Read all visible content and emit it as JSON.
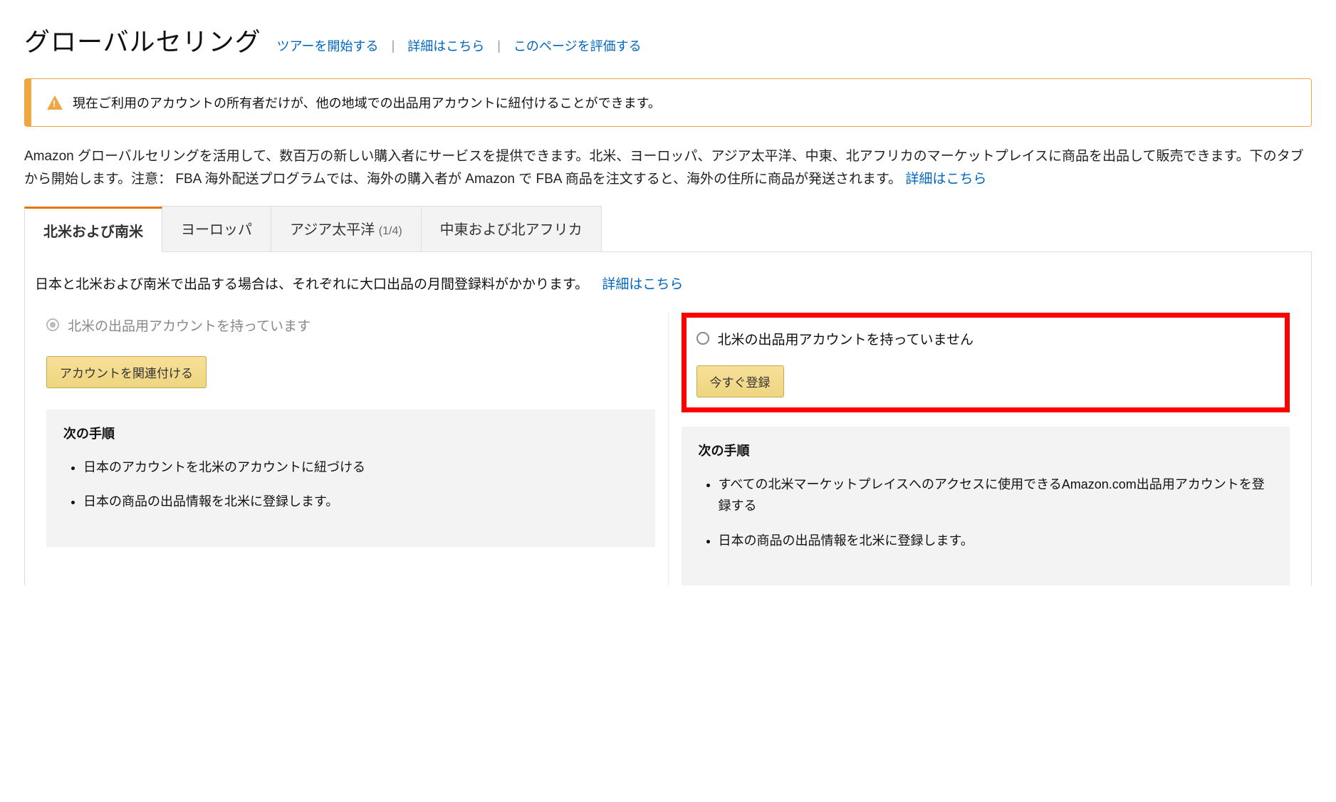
{
  "header": {
    "title": "グローバルセリング",
    "links": {
      "tour": "ツアーを開始する",
      "details": "詳細はこちら",
      "rate": "このページを評価する"
    }
  },
  "alert": {
    "text": "現在ご利用のアカウントの所有者だけが、他の地域での出品用アカウントに紐付けることができます。"
  },
  "description": {
    "text": "Amazon グローバルセリングを活用して、数百万の新しい購入者にサービスを提供できます。北米、ヨーロッパ、アジア太平洋、中東、北アフリカのマーケットプレイスに商品を出品して販売できます。下のタブから開始します。注意： FBA 海外配送プログラムでは、海外の購入者が Amazon で FBA 商品を注文すると、海外の住所に商品が発送されます。",
    "link": "詳細はこちら"
  },
  "tabs": [
    {
      "label": "北米および南米",
      "sub": ""
    },
    {
      "label": "ヨーロッパ",
      "sub": ""
    },
    {
      "label": "アジア太平洋",
      "sub": "(1/4)"
    },
    {
      "label": "中東および北アフリカ",
      "sub": ""
    }
  ],
  "tab_content": {
    "intro": "日本と北米および南米で出品する場合は、それぞれに大口出品の月間登録料がかかります。",
    "intro_link": "詳細はこちら",
    "left": {
      "option": "北米の出品用アカウントを持っています",
      "button": "アカウントを関連付ける",
      "steps_title": "次の手順",
      "steps": [
        "日本のアカウントを北米のアカウントに紐づける",
        "日本の商品の出品情報を北米に登録します。"
      ]
    },
    "right": {
      "option": "北米の出品用アカウントを持っていません",
      "button": "今すぐ登録",
      "steps_title": "次の手順",
      "steps": [
        "すべての北米マーケットプレイスへのアクセスに使用できるAmazon.com出品用アカウントを登録する",
        "日本の商品の出品情報を北米に登録します。"
      ]
    }
  }
}
